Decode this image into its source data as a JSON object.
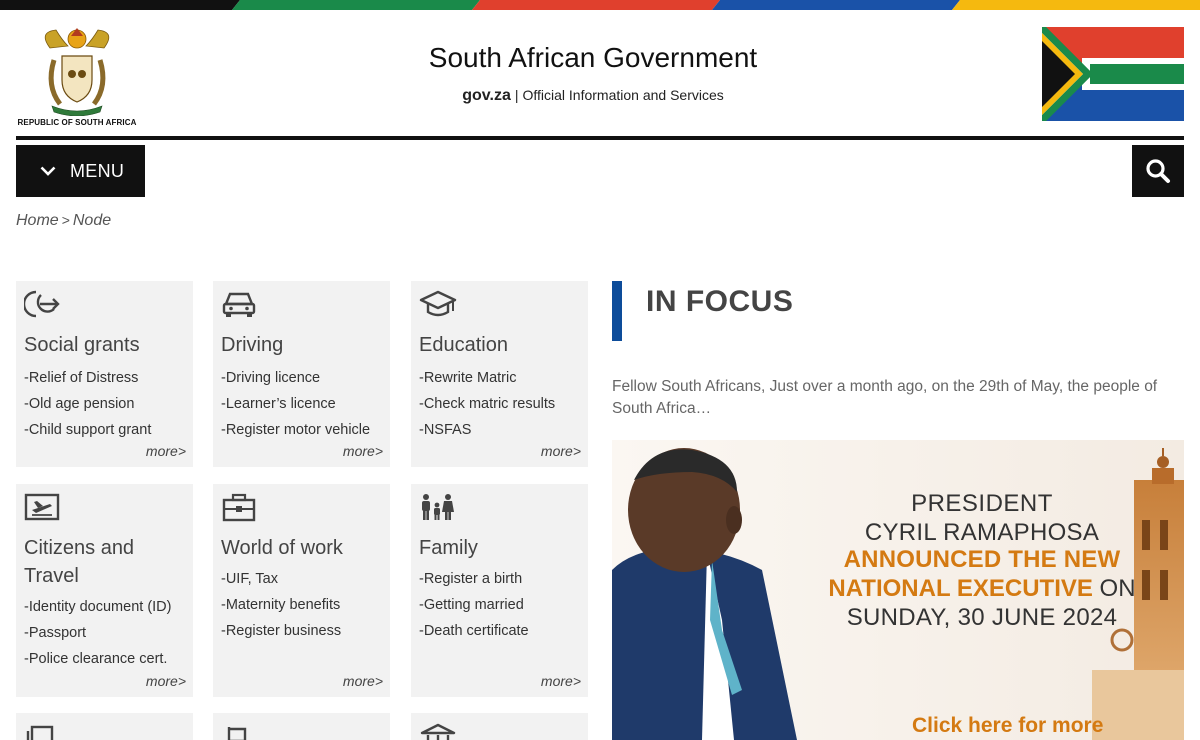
{
  "colors": {
    "stripe": [
      "#111111",
      "#1a8a4a",
      "#e0402d",
      "#1a52a8",
      "#f5b90f"
    ],
    "accent_bar": "#0d4c9a",
    "banner_orange": "#d47a12"
  },
  "header": {
    "coat_label": "REPUBLIC OF SOUTH AFRICA",
    "title": "South African Government",
    "domain": "gov.za",
    "separator": "|",
    "tagline": "Official Information and Services"
  },
  "nav": {
    "menu_label": "MENU",
    "menu_icon": "chevron-down-icon",
    "search_icon": "search-icon"
  },
  "breadcrumb": {
    "home": "Home",
    "separator": ">",
    "current": "Node"
  },
  "cards": [
    {
      "icon": "social-grants-icon",
      "title": "Social grants",
      "links": [
        "-Relief of Distress",
        "-Old age pension",
        "-Child support grant"
      ],
      "more": "more>"
    },
    {
      "icon": "car-icon",
      "title": "Driving",
      "links": [
        "-Driving licence",
        "-Learner’s licence",
        "-Register motor vehicle"
      ],
      "more": "more>"
    },
    {
      "icon": "graduation-cap-icon",
      "title": "Education",
      "links": [
        "-Rewrite Matric",
        "-Check matric results",
        "-NSFAS"
      ],
      "more": "more>"
    },
    {
      "icon": "plane-ticket-icon",
      "title": "Citizens and Travel",
      "links": [
        "-Identity document (ID)",
        "-Passport",
        "-Police clearance cert."
      ],
      "more": "more>"
    },
    {
      "icon": "briefcase-icon",
      "title": "World of work",
      "links": [
        "-UIF, Tax",
        "-Maternity benefits",
        "-Register business"
      ],
      "more": "more>"
    },
    {
      "icon": "family-icon",
      "title": "Family",
      "links": [
        "-Register a birth",
        "-Getting married",
        "-Death certificate"
      ],
      "more": "more>"
    }
  ],
  "focus": {
    "title": "IN FOCUS",
    "excerpt": "Fellow South Africans,  Just over a month ago, on the 29th of May, the people of South Africa…",
    "banner": {
      "line1": "PRESIDENT",
      "line2": "CYRIL RAMAPHOSA",
      "line3": "ANNOUNCED THE NEW",
      "line4_bold": "NATIONAL EXECUTIVE",
      "line4_rest": " ON",
      "line5": "SUNDAY, 30 JUNE 2024",
      "cta": "Click here for more"
    }
  }
}
